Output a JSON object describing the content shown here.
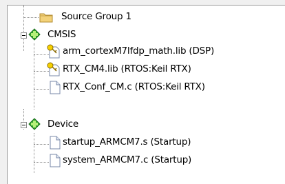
{
  "tree": {
    "source_group": {
      "label": "Source Group 1",
      "icon": "folder-icon"
    },
    "cmsis": {
      "label": "CMSIS",
      "icon": "component-diamond-icon",
      "expanded": true,
      "children": [
        {
          "label": "arm_cortexM7lfdp_math.lib (DSP)",
          "icon": "library-key-icon"
        },
        {
          "label": "RTX_CM4.lib (RTOS:Keil RTX)",
          "icon": "library-key-icon"
        },
        {
          "label": "RTX_Conf_CM.c (RTOS:Keil RTX)",
          "icon": "file-icon"
        }
      ]
    },
    "device": {
      "label": "Device",
      "icon": "component-diamond-icon",
      "expanded": true,
      "children": [
        {
          "label": "startup_ARMCM7.s (Startup)",
          "icon": "file-icon"
        },
        {
          "label": "system_ARMCM7.c (Startup)",
          "icon": "file-icon"
        }
      ]
    },
    "colors": {
      "diamond": "#2fa82f",
      "folder": "#f3d27a",
      "key": "#d9a400"
    }
  }
}
